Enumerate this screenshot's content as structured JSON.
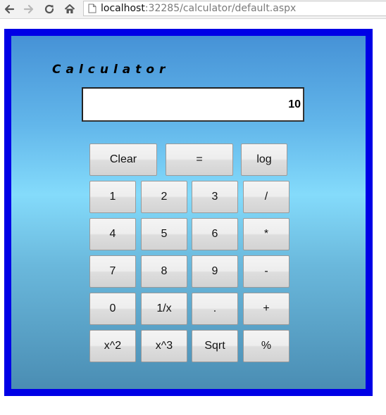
{
  "browser": {
    "url_host": "localhost",
    "url_rest": ":32285/calculator/default.aspx",
    "icons": [
      "back-icon",
      "forward-icon",
      "reload-icon",
      "home-icon",
      "page-icon"
    ]
  },
  "calculator": {
    "title": "Calculator",
    "display_value": "10",
    "colors": {
      "frame": "#0000e6",
      "gradient_top": "#4692d6",
      "gradient_mid": "#84dbfb",
      "gradient_bottom": "#4a8db3"
    },
    "rows": [
      [
        "Clear",
        "=",
        "log"
      ],
      [
        "1",
        "2",
        "3",
        "/"
      ],
      [
        "4",
        "5",
        "6",
        "*"
      ],
      [
        "7",
        "8",
        "9",
        "-"
      ],
      [
        "0",
        "1/x",
        ".",
        "+"
      ],
      [
        "x^2",
        "x^3",
        "Sqrt",
        "%"
      ]
    ]
  }
}
